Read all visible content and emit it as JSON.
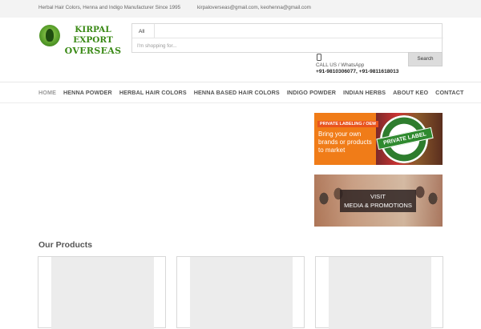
{
  "topbar": {
    "tagline": "Herbal Hair Colors, Henna and Indigo Manufacturer Since 1995",
    "emails": "kirpaloverseas@gmail.com, keohenna@gmail.com"
  },
  "logo": {
    "line1": "KIRPAL EXPORT",
    "line2": "OVERSEAS"
  },
  "search": {
    "category": "All",
    "placeholder": "I'm shopping for...",
    "button_label": "Search"
  },
  "contact": {
    "label": "CALL US / WhatsApp",
    "phones": "+91-9810306077, +91-9811618013"
  },
  "nav": {
    "items": [
      {
        "label": "HOME",
        "active": true
      },
      {
        "label": "HENNA POWDER"
      },
      {
        "label": "HERBAL HAIR COLORS"
      },
      {
        "label": "HENNA BASED HAIR COLORS"
      },
      {
        "label": "INDIGO POWDER"
      },
      {
        "label": "INDIAN HERBS"
      },
      {
        "label": "ABOUT KEO"
      },
      {
        "label": "CONTACT"
      }
    ]
  },
  "banners": {
    "private_label": {
      "tag": "PRIVATE LABELING / OEM",
      "text": "Bring your own brands or products to market",
      "seal": "PRIVATE LABEL"
    },
    "media": {
      "line1": "VISIT",
      "line2": "MEDIA & PROMOTIONS"
    }
  },
  "products": {
    "title": "Our Products"
  },
  "colors": {
    "brand_green": "#3b8a17",
    "banner_orange": "#f07c18",
    "nav_text": "#555555"
  }
}
